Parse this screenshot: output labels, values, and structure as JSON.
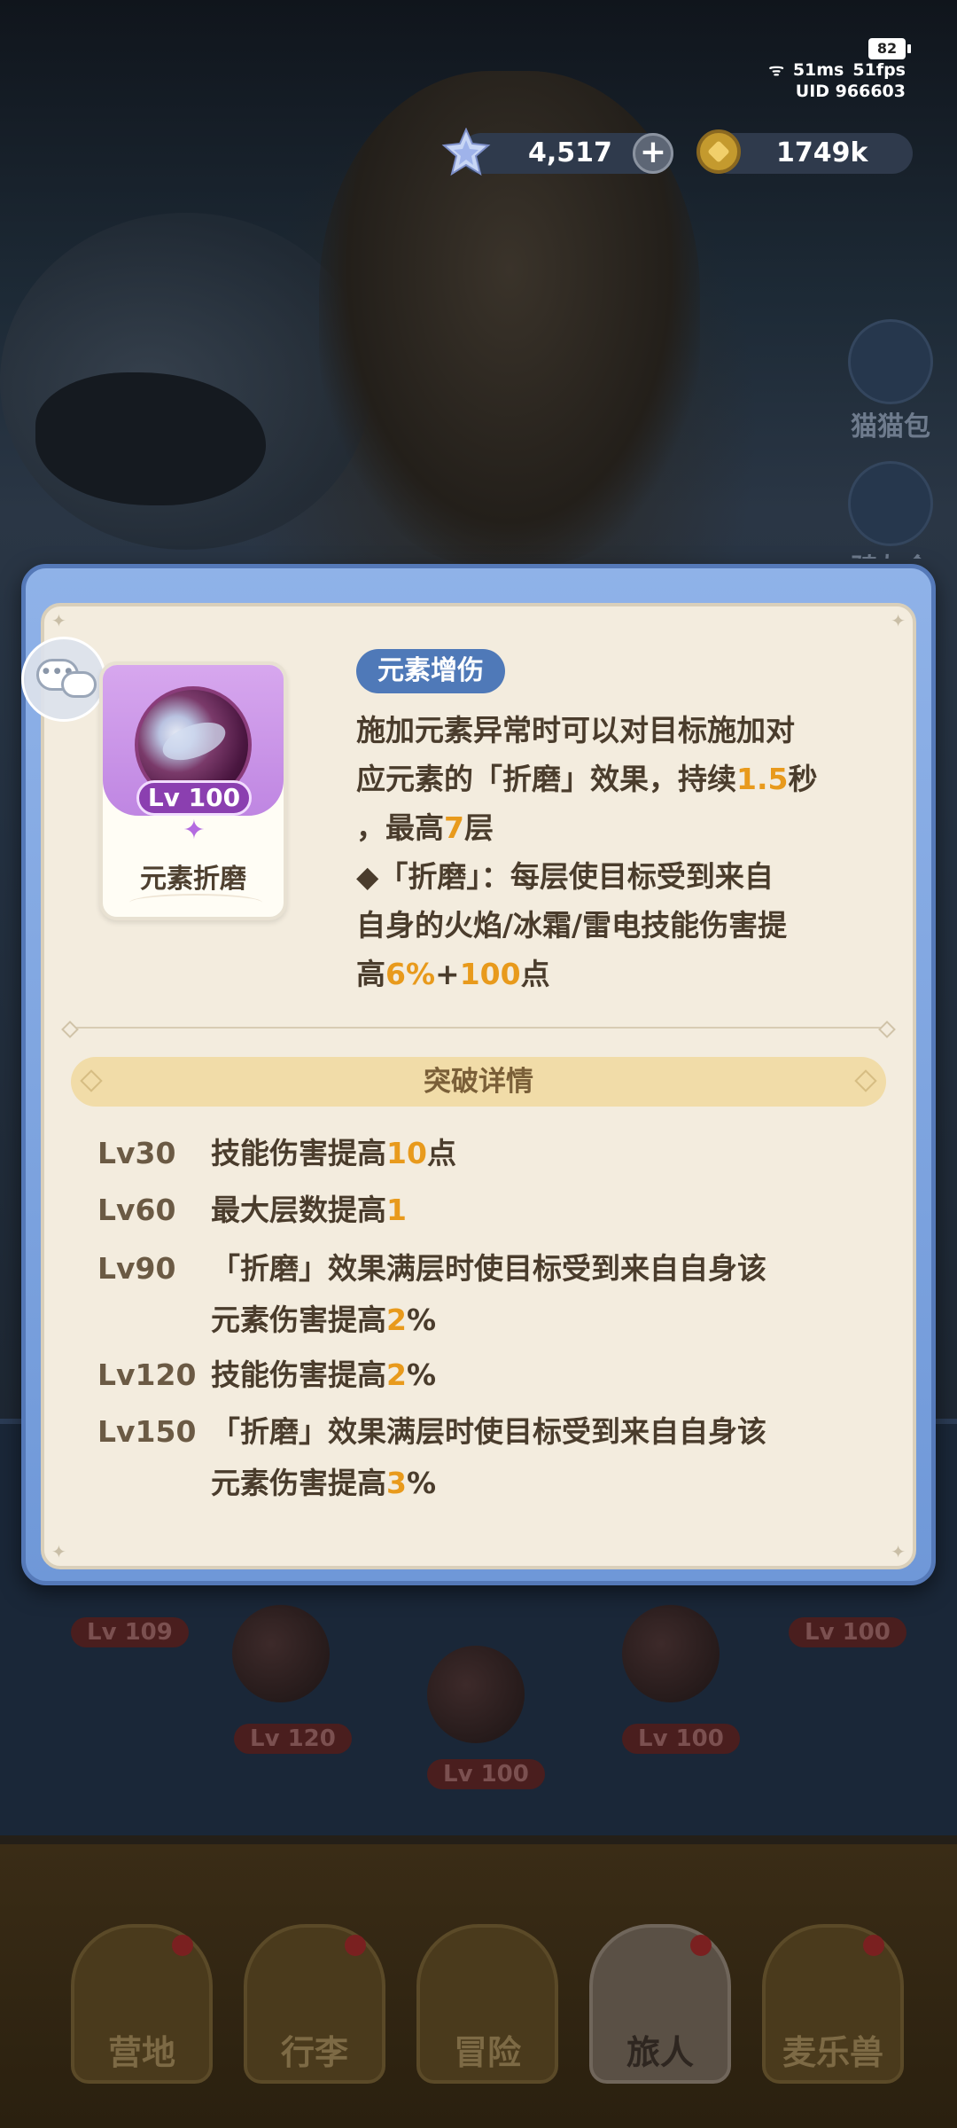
{
  "status": {
    "battery": "82",
    "ping": "51ms",
    "fps": "51fps",
    "uid": "UID 966603"
  },
  "currency": {
    "gems": "4,517",
    "gold": "1749k"
  },
  "side_menu": [
    "猫猫包",
    "骑友会"
  ],
  "bottom_nav": [
    "营地",
    "行李",
    "冒险",
    "旅人",
    "麦乐兽"
  ],
  "background_levels": [
    "Lv 109",
    "Lv 100",
    "Lv 120",
    "Lv 100",
    "Lv 100"
  ],
  "popup": {
    "skill_card": {
      "level": "Lv 100",
      "name": "元素折磨"
    },
    "tag": "元素增伤",
    "description": [
      [
        "施加元素异常时可以对目标施加对"
      ],
      [
        "应元素的「折磨」效果，持续",
        "1.5",
        "秒"
      ],
      [
        "，最高",
        "7",
        "层"
      ],
      [
        "◆「折磨」：每层使目标受到来自"
      ],
      [
        "自身的火焰/冰霜/雷电技能伤害提"
      ],
      [
        "高",
        "6%",
        "+",
        "100",
        "点"
      ]
    ],
    "breakthrough_title": "突破详情",
    "breakthrough": [
      {
        "level": "Lv30",
        "lines": [
          [
            "技能伤害提高",
            "10",
            "点"
          ]
        ]
      },
      {
        "level": "Lv60",
        "lines": [
          [
            "最大层数提高",
            "1",
            ""
          ]
        ]
      },
      {
        "level": "Lv90",
        "lines": [
          [
            "「折磨」效果满层时使目标受到来自自身该"
          ],
          [
            "元素伤害提高",
            "2",
            "%"
          ]
        ]
      },
      {
        "level": "Lv120",
        "lines": [
          [
            "技能伤害提高",
            "2",
            "%"
          ]
        ]
      },
      {
        "level": "Lv150",
        "lines": [
          [
            "「折磨」效果满层时使目标受到来自自身该"
          ],
          [
            "元素伤害提高",
            "3",
            "%"
          ]
        ]
      }
    ]
  },
  "colors": {
    "highlight": "#e89a1c",
    "tag_bg": "#4f79b8",
    "popup_frame": "#6f98d8",
    "popup_body": "#f3ecde"
  }
}
